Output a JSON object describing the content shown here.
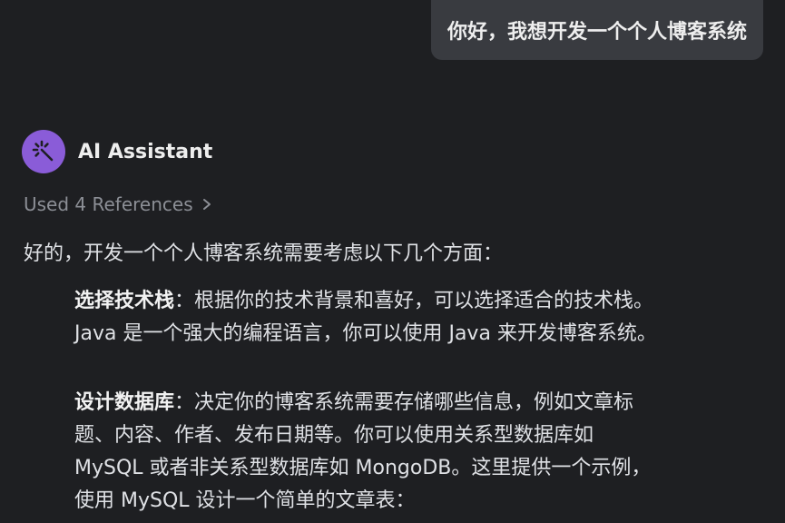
{
  "user_message": {
    "text": "你好，我想开发一个个人博客系统"
  },
  "assistant": {
    "avatar_icon": "magic-wand-icon",
    "name": "AI Assistant",
    "references_label": "Used 4 References",
    "intro": "好的，开发一个个人博客系统需要考虑以下几个方面："
  },
  "points": [
    {
      "title": "选择技术栈",
      "sep": "：",
      "line1": "根据你的技术背景和喜好，可以选择适合的技术栈。",
      "line2": "Java 是一个强大的编程语言，你可以使用 Java 来开发博客系统。"
    },
    {
      "title": "设计数据库",
      "sep": "：",
      "line1": "决定你的博客系统需要存储哪些信息，例如文章标",
      "line2": "题、内容、作者、发布日期等。你可以使用关系型数据库如",
      "line3": "MySQL 或者非关系型数据库如 MongoDB。这里提供一个示例，",
      "line4": "使用 MySQL 设计一个简单的文章表："
    }
  ],
  "colors": {
    "background": "#1e1f22",
    "bubble": "#393b40",
    "avatar": "#8a5cd8",
    "muted_text": "#8c8f96",
    "text": "#dfe1e5"
  }
}
